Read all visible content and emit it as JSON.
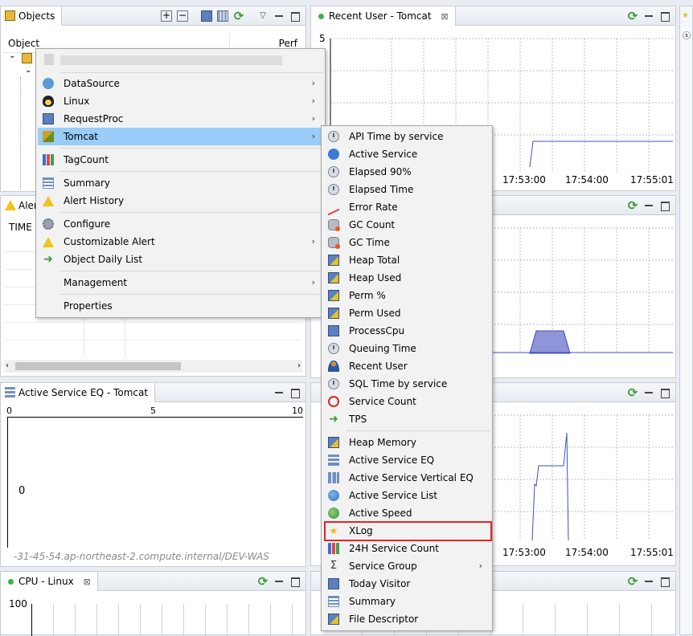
{
  "objects_panel": {
    "tab_label": "Objects",
    "col_object": "Object",
    "col_perf": "Perf"
  },
  "alert_panel": {
    "tab_label": "Aler",
    "col_time": "TIME"
  },
  "active_service_panel": {
    "tab_label": "Active Service EQ - Tomcat",
    "tick_0": "0",
    "tick_5": "5",
    "tick_10": "10",
    "value": "0",
    "footer": "-31-45-54.ap-northeast-2.compute.internal/DEV-WAS"
  },
  "cpu_panel": {
    "tab_label": "CPU - Linux",
    "y_tick": "100"
  },
  "recent_user_panel": {
    "tab_label": "Recent User - Tomcat",
    "y_tick": "5"
  },
  "time_ticks": [
    "17:53:00",
    "17:54:00",
    "17:55:01"
  ],
  "first_menu": {
    "items": [
      {
        "label": "DataSource",
        "icon": "datasource-icon",
        "submenu": true
      },
      {
        "label": "Linux",
        "icon": "linux-icon",
        "submenu": true
      },
      {
        "label": "RequestProc",
        "icon": "requestproc-icon",
        "submenu": true
      },
      {
        "label": "Tomcat",
        "icon": "tomcat-icon",
        "submenu": true,
        "active": true
      },
      {
        "label": "TagCount",
        "icon": "tagcount-icon"
      },
      {
        "label": "Summary",
        "icon": "summary-icon"
      },
      {
        "label": "Alert History",
        "icon": "alert-history-icon"
      },
      {
        "label": "Configure",
        "icon": "configure-icon"
      },
      {
        "label": "Customizable Alert",
        "icon": "customizable-alert-icon",
        "submenu": true
      },
      {
        "label": "Object Daily List",
        "icon": "object-daily-list-icon"
      },
      {
        "label": "Management",
        "submenu": true
      },
      {
        "label": "Properties"
      }
    ]
  },
  "tomcat_submenu": {
    "items": [
      {
        "label": "API Time by service"
      },
      {
        "label": "Active Service"
      },
      {
        "label": "Elapsed 90%"
      },
      {
        "label": "Elapsed Time"
      },
      {
        "label": "Error Rate"
      },
      {
        "label": "GC Count"
      },
      {
        "label": "GC Time"
      },
      {
        "label": "Heap Total"
      },
      {
        "label": "Heap Used"
      },
      {
        "label": "Perm %"
      },
      {
        "label": "Perm Used"
      },
      {
        "label": "ProcessCpu"
      },
      {
        "label": "Queuing Time"
      },
      {
        "label": "Recent User"
      },
      {
        "label": "SQL Time by service"
      },
      {
        "label": "Service Count"
      },
      {
        "label": "TPS"
      },
      {
        "label": "Heap Memory"
      },
      {
        "label": "Active Service EQ"
      },
      {
        "label": "Active Service Vertical EQ"
      },
      {
        "label": "Active Service List"
      },
      {
        "label": "Active Speed"
      },
      {
        "label": "XLog",
        "highlighted": true
      },
      {
        "label": "24H Service Count"
      },
      {
        "label": "Service Group",
        "submenu": true
      },
      {
        "label": "Today Visitor"
      },
      {
        "label": "Summary"
      },
      {
        "label": "File Descriptor"
      }
    ]
  },
  "colors": {
    "menu_active": "#99ccf7",
    "highlight_border": "#e2232a",
    "series_line": "#3f51b5",
    "series_fill": "#8f95d8"
  }
}
